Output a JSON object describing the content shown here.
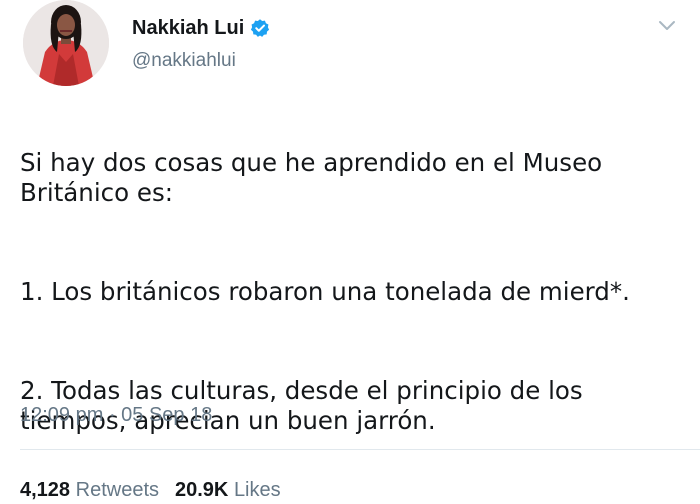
{
  "tweet": {
    "display_name": "Nakkiah Lui",
    "handle": "@nakkiahlui",
    "verified": true,
    "body": [
      "Si hay dos cosas que he aprendido en el Museo Británico es:",
      "1. Los británicos robaron una tonelada de mierd*.",
      "2. Todas las culturas, desde el principio de los tiempos, aprecian un buen jarrón."
    ],
    "timestamp": "12:09 pm · 05 Sep 18",
    "retweets_count": "4,128",
    "retweets_label": "Retweets",
    "likes_count": "20.9K",
    "likes_label": "Likes"
  },
  "icons": {
    "verified": "verified-badge-icon",
    "menu": "chevron-down-icon"
  },
  "colors": {
    "text": "#14171a",
    "secondary_text": "#657786",
    "verified": "#1da1f2",
    "divider": "#e1e8ed"
  }
}
